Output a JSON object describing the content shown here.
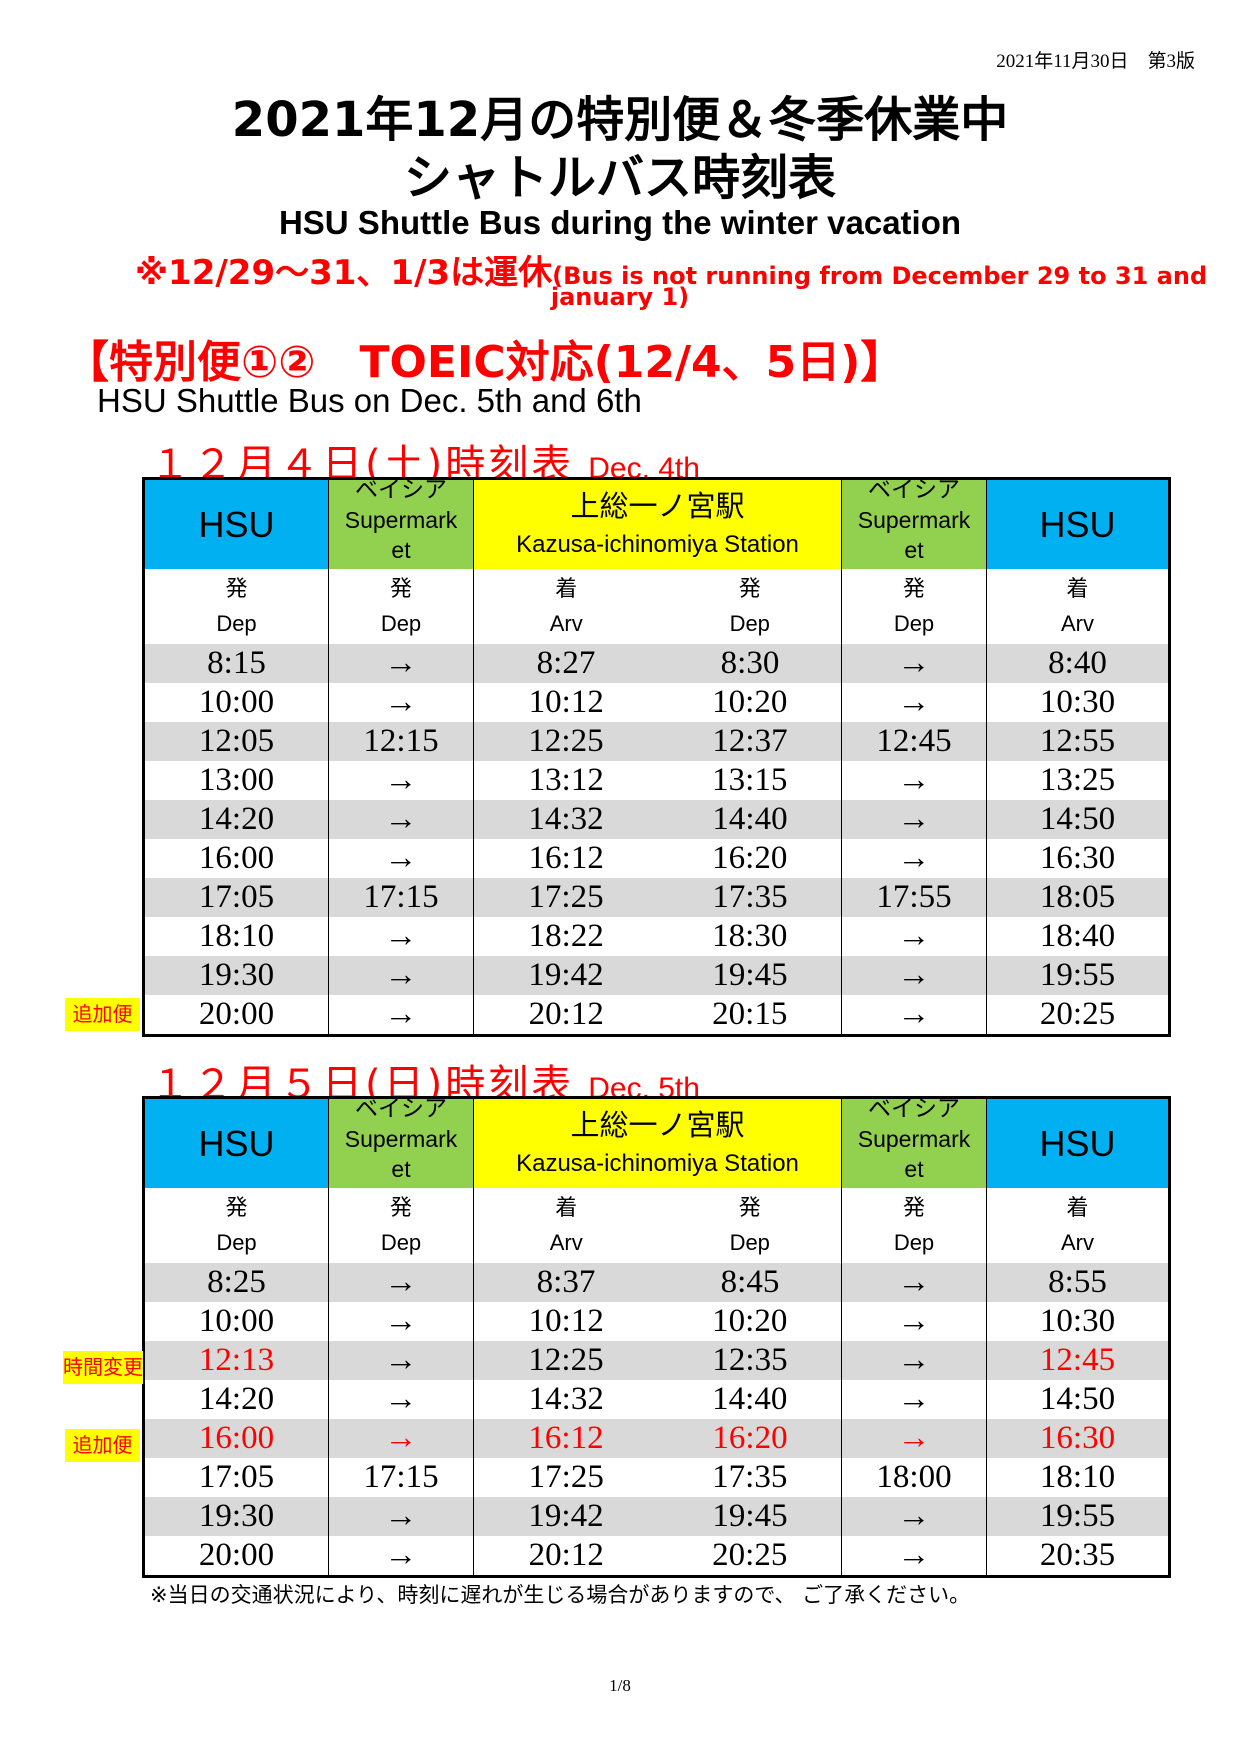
{
  "header": {
    "version": "2021年11月30日　第3版",
    "title_line1": "2021年12月の特別便＆冬季休業中",
    "title_line2": "シャトルバス時刻表",
    "subtitle_en": "HSU Shuttle Bus during the winter vacation",
    "notice_jp": "※12/29～31、1/3は運休",
    "notice_en_part1": "(Bus is not running from December 29 to 31 and",
    "notice_en_part2": "january 1)"
  },
  "section": {
    "title": "【特別便①②　TOEIC対応(12/4、5日)】",
    "subtitle_en": "HSU Shuttle Bus on Dec. 5th and 6th"
  },
  "columns": {
    "hsu": "HSU",
    "supermarket_jp": "ベイシア",
    "supermarket_en": "Supermark",
    "supermarket_en2": "et",
    "station_jp": "上総一ノ宮駅",
    "station_en": "Kazusa-ichinomiya Station",
    "dep_jp": "発",
    "dep_en": "Dep",
    "arv_jp": "着",
    "arv_en": "Arv"
  },
  "day1": {
    "title_jp": "１２月４日(土)時刻表",
    "title_en": "Dec. 4th",
    "extra_label": "追加便",
    "rows": [
      [
        "8:15",
        "→",
        "8:27",
        "8:30",
        "→",
        "8:40"
      ],
      [
        "10:00",
        "→",
        "10:12",
        "10:20",
        "→",
        "10:30"
      ],
      [
        "12:05",
        "12:15",
        "12:25",
        "12:37",
        "12:45",
        "12:55"
      ],
      [
        "13:00",
        "→",
        "13:12",
        "13:15",
        "→",
        "13:25"
      ],
      [
        "14:20",
        "→",
        "14:32",
        "14:40",
        "→",
        "14:50"
      ],
      [
        "16:00",
        "→",
        "16:12",
        "16:20",
        "→",
        "16:30"
      ],
      [
        "17:05",
        "17:15",
        "17:25",
        "17:35",
        "17:55",
        "18:05"
      ],
      [
        "18:10",
        "→",
        "18:22",
        "18:30",
        "→",
        "18:40"
      ],
      [
        "19:30",
        "→",
        "19:42",
        "19:45",
        "→",
        "19:55"
      ],
      [
        "20:00",
        "→",
        "20:12",
        "20:15",
        "→",
        "20:25"
      ]
    ]
  },
  "day2": {
    "title_jp": "１２月５日(日)時刻表",
    "title_en": "Dec. 5th",
    "changed_label": "時間変更",
    "extra_label": "追加便",
    "rows": [
      [
        "8:25",
        "→",
        "8:37",
        "8:45",
        "→",
        "8:55"
      ],
      [
        "10:00",
        "→",
        "10:12",
        "10:20",
        "→",
        "10:30"
      ],
      [
        "12:13",
        "→",
        "12:25",
        "12:35",
        "→",
        "12:45"
      ],
      [
        "14:20",
        "→",
        "14:32",
        "14:40",
        "→",
        "14:50"
      ],
      [
        "16:00",
        "→",
        "16:12",
        "16:20",
        "→",
        "16:30"
      ],
      [
        "17:05",
        "17:15",
        "17:25",
        "17:35",
        "18:00",
        "18:10"
      ],
      [
        "19:30",
        "→",
        "19:42",
        "19:45",
        "→",
        "19:55"
      ],
      [
        "20:00",
        "→",
        "20:12",
        "20:25",
        "→",
        "20:35"
      ]
    ]
  },
  "footnote": "※当日の交通状況により、時刻に遅れが生じる場合がありますので、 ご了承ください。",
  "page_number": "1/8",
  "colors": {
    "hsu_header": "#00b0f0",
    "supermarket_header": "#92d050",
    "station_header": "#ffff00",
    "shaded_row": "#d9d9d9",
    "emphasis": "#ff0000"
  }
}
